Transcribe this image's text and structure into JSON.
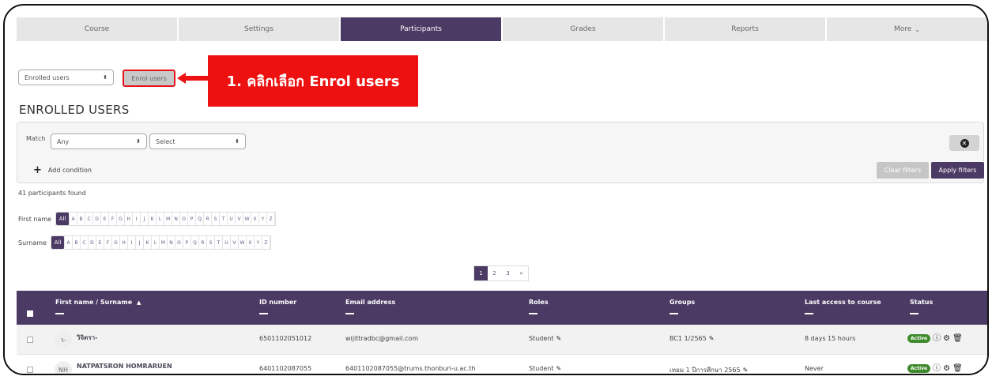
{
  "tabs": [
    "Course",
    "Settings",
    "Participants",
    "Grades",
    "Reports",
    "More"
  ],
  "active_tab": "Participants",
  "more_chevron": "⌄",
  "enrolled_select": "Enrolled users",
  "enrol_button": "Enrol users",
  "callout_text": "1. คลิกเลือก Enrol users",
  "heading": "ENROLLED USERS",
  "filter": {
    "match_label": "Match",
    "match_value": "Any",
    "select_value": "Select",
    "add_condition": "Add condition",
    "clear_filters": "Clear filters",
    "apply_filters": "Apply filters"
  },
  "participants_found": "41 participants found",
  "first_name_label": "First name",
  "surname_label": "Surname",
  "letters": [
    "All",
    "A",
    "B",
    "C",
    "D",
    "E",
    "F",
    "G",
    "H",
    "I",
    "J",
    "K",
    "L",
    "M",
    "N",
    "O",
    "P",
    "Q",
    "R",
    "S",
    "T",
    "U",
    "V",
    "W",
    "X",
    "Y",
    "Z"
  ],
  "pages": [
    "1",
    "2",
    "3",
    "»"
  ],
  "table": {
    "headers": {
      "name": "First name / Surname",
      "id": "ID number",
      "email": "Email address",
      "roles": "Roles",
      "groups": "Groups",
      "last_access": "Last access to course",
      "status": "Status"
    },
    "rows": [
      {
        "avatar": "ว-",
        "name": "วิจิตรา-",
        "id": "6501102051012",
        "email": "wijittradbc@gmail.com",
        "role": "Student",
        "group": "BC1 1/2565",
        "last_access": "8 days 15 hours",
        "status": "Active"
      },
      {
        "avatar": "NH",
        "name": "NATPATSRON HOMRARUEN",
        "id": "6401102087055",
        "email": "6401102087055@trums.thonburi-u.ac.th",
        "role": "Student",
        "group": "เทอม 1 ปีการศึกษา 2565",
        "last_access": "Never",
        "status": "Active"
      }
    ]
  },
  "colors": {
    "primary": "#4b3a63",
    "callout": "#ee1111",
    "active_badge": "#3f8a2c"
  }
}
